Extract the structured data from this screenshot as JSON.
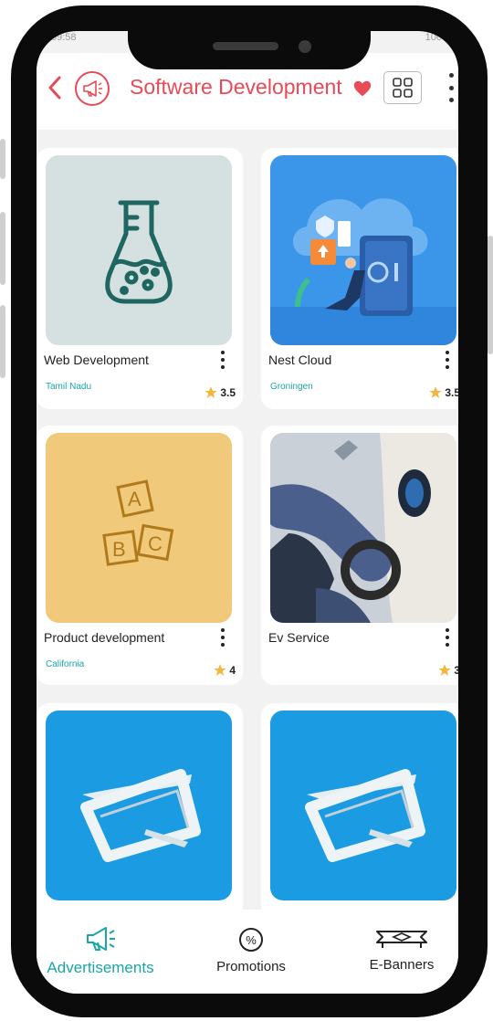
{
  "status": {
    "time": "09:58",
    "battery": "100"
  },
  "header": {
    "title": "Software Development"
  },
  "icons": {
    "back": "chevron-left-icon",
    "ad": "megaphone-icon",
    "favorite": "heart-icon",
    "layout": "grid-view-icon",
    "more": "kebab-menu-icon"
  },
  "colors": {
    "accent": "#e94a57",
    "teal": "#1aa6a6",
    "star": "#f3b53c"
  },
  "listings": [
    {
      "name": "Web Development",
      "location": "Tamil Nadu",
      "rating": "3.5",
      "image": "flask-icon"
    },
    {
      "name": "Nest Cloud",
      "location": "Groningen",
      "rating": "3.5",
      "image": "cloud-server-illustration"
    },
    {
      "name": "Product development",
      "location": "California",
      "rating": "4",
      "image": "abc-blocks-icon"
    },
    {
      "name": "Ev Service",
      "location": "",
      "rating": "3",
      "image": "ev-charging-photo"
    },
    {
      "name": "",
      "location": "",
      "rating": "",
      "image": "set-square-3d"
    },
    {
      "name": "",
      "location": "",
      "rating": "",
      "image": "set-square-3d"
    }
  ],
  "nav": [
    {
      "label": "Advertisements",
      "icon": "megaphone-icon",
      "active": true
    },
    {
      "label": "Promotions",
      "icon": "percent-badge-icon",
      "active": false
    },
    {
      "label": "E-Banners",
      "icon": "banner-icon",
      "active": false
    }
  ]
}
